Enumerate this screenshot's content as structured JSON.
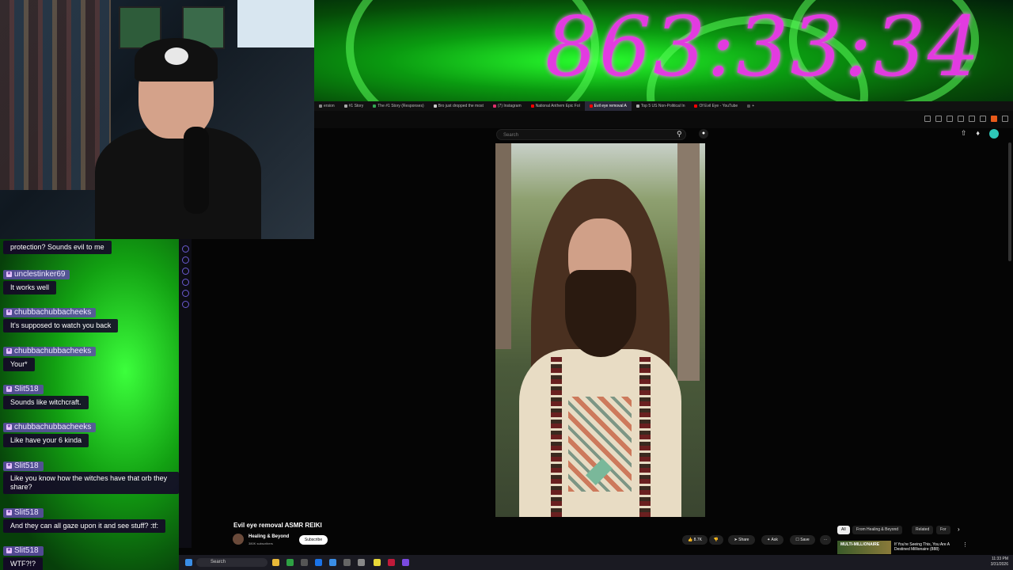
{
  "stream": {
    "timer": "863:33:34"
  },
  "browser": {
    "tabs": [
      {
        "label": "ersion",
        "color": "#888888"
      },
      {
        "label": "#1 Story",
        "color": "#aaaaaa"
      },
      {
        "label": "The #1 Story (Responses)",
        "color": "#34a853"
      },
      {
        "label": "Bro just dropped the most",
        "color": "#cccccc"
      },
      {
        "label": "(7) Instagram",
        "color": "#e1306c"
      },
      {
        "label": "National Anthem Epic Fol",
        "color": "#ff0000"
      },
      {
        "label": "Evil eye removal A",
        "color": "#ff0000",
        "active": true
      },
      {
        "label": "Top 5 US Non-Political In",
        "color": "#aaaaaa"
      },
      {
        "label": "Of Evil Eye - YouTube",
        "color": "#ff0000"
      },
      {
        "label": "+",
        "color": "#555555"
      }
    ]
  },
  "youtube": {
    "search_placeholder": "Search",
    "video_title": "Evil eye removal ASMR REIKI",
    "channel_name": "Healing & Beyond",
    "channel_subs": "380K subscribers",
    "subscribe_label": "Subscribe",
    "likes": "8.7K",
    "share_label": "Share",
    "ask_label": "Ask",
    "save_label": "Save",
    "chips": [
      "All",
      "From Healing & Beyond",
      "Related",
      "For"
    ],
    "recommended": {
      "thumb_text": "MULTI-MILLIONAIRE",
      "title": "If You're Seeing This, You Are A Destined Millionaire (888)"
    }
  },
  "chat": {
    "messages": [
      {
        "user": "",
        "text": "protection? Sounds evil to me"
      },
      {
        "user": "unclestinker69",
        "text": "It works well"
      },
      {
        "user": "chubbachubbacheeks",
        "text": "It's supposed to watch you back"
      },
      {
        "user": "chubbachubbacheeks",
        "text": "Your*"
      },
      {
        "user": "Slit518",
        "text": "Sounds like witchcraft."
      },
      {
        "user": "chubbachubbacheeks",
        "text": "Like have your 6 kinda"
      },
      {
        "user": "Slit518",
        "text": "Like you know how the witches have that orb they share?"
      },
      {
        "user": "Slit518",
        "text": "And they can all gaze upon it and see stuff? :tf:"
      },
      {
        "user": "Slit518",
        "text": "WTF?!?"
      }
    ]
  },
  "taskbar": {
    "search_label": "Search",
    "time": "11:33 PM",
    "date": "3/31/2026"
  }
}
